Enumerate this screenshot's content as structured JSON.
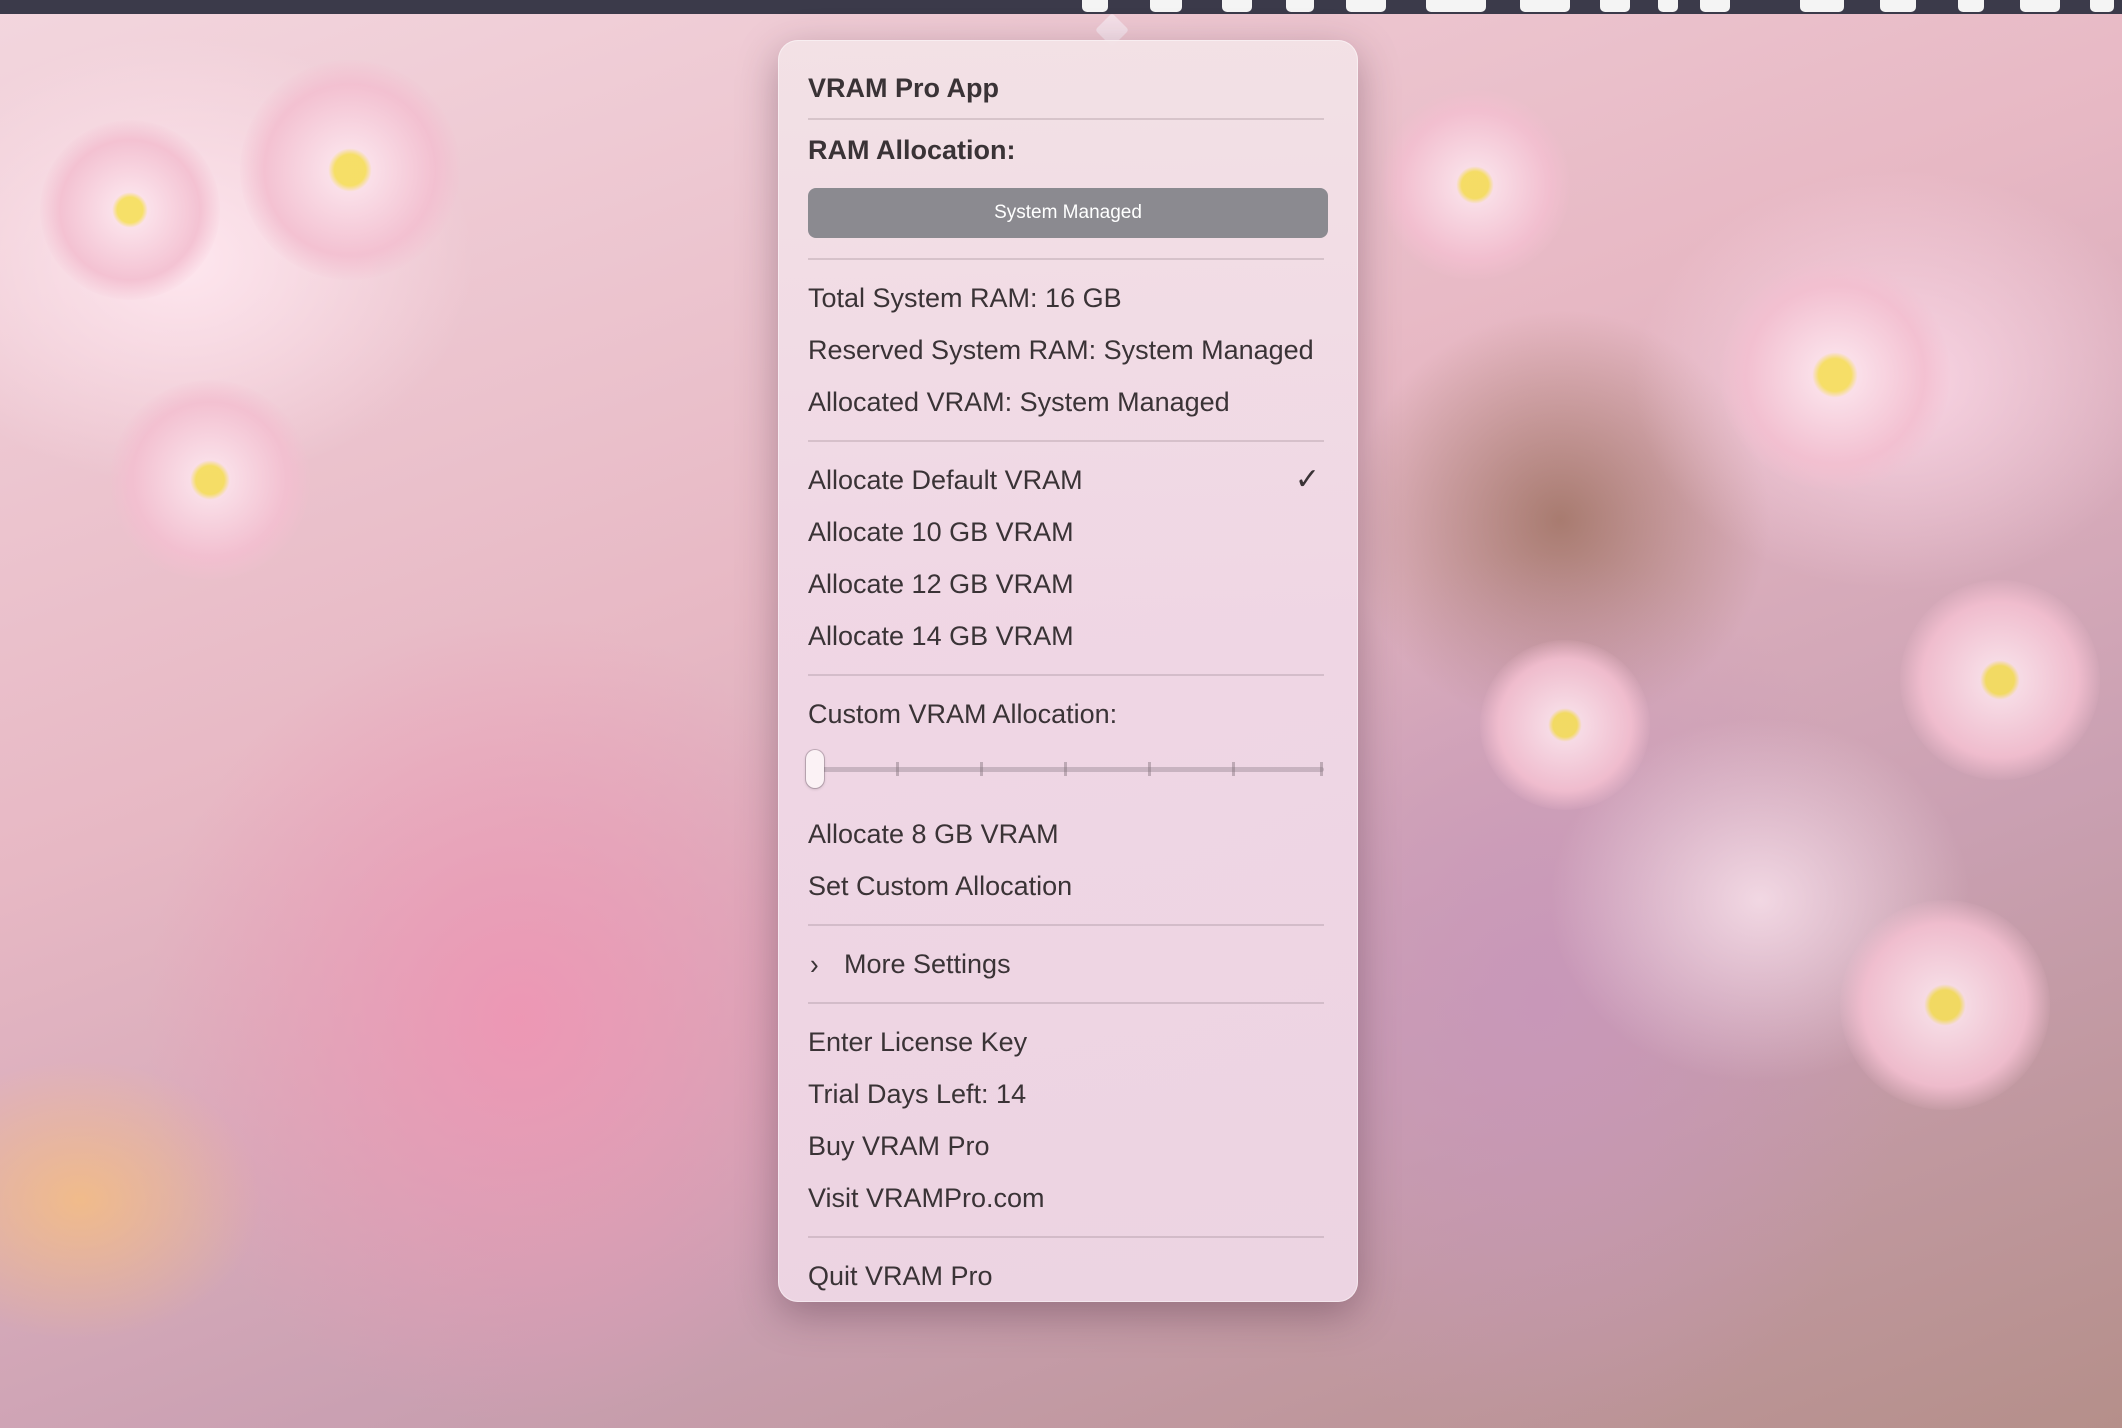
{
  "menu": {
    "title": "VRAM Pro App",
    "ram_allocation_heading": "RAM Allocation:",
    "ram_mode_button": "System Managed",
    "info": {
      "total_system_ram": "Total System RAM: 16 GB",
      "reserved_system_ram": "Reserved System RAM: System Managed",
      "allocated_vram": "Allocated VRAM: System Managed"
    },
    "presets": [
      {
        "label": "Allocate Default VRAM",
        "checked": true,
        "check_glyph": "✓"
      },
      {
        "label": "Allocate 10 GB VRAM"
      },
      {
        "label": "Allocate 12 GB VRAM"
      },
      {
        "label": "Allocate 14 GB VRAM"
      }
    ],
    "custom": {
      "heading": "Custom VRAM Allocation:",
      "slider_value": 0,
      "allocate_label": "Allocate 8 GB VRAM",
      "set_label": "Set Custom Allocation"
    },
    "more_settings": {
      "label": "More Settings",
      "chevron_glyph": "›"
    },
    "license": {
      "enter_key": "Enter License Key",
      "trial_days": "Trial Days Left: 14",
      "buy": "Buy VRAM Pro",
      "visit": "Visit VRAMPro.com"
    },
    "quit": "Quit VRAM Pro"
  }
}
